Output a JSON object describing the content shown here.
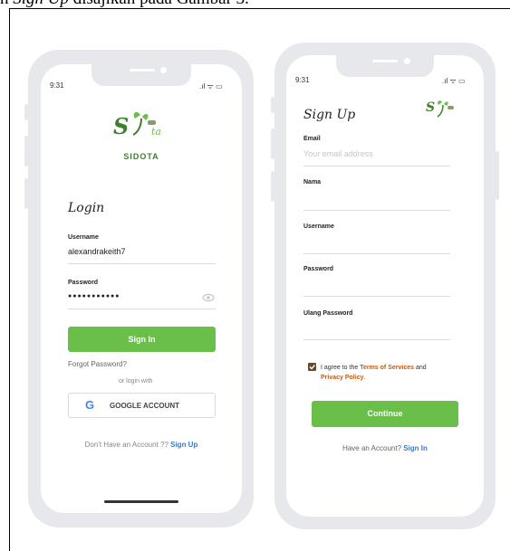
{
  "caption": {
    "prefix": "n ",
    "italic": "Sign Up",
    "suffix": " disajikan pada Gambar 3."
  },
  "login": {
    "time": "9:31",
    "signal": ".ıl ᯤ ▭",
    "brand": "SIDOTA",
    "logo_text": "S",
    "logo_script": "ta",
    "title": "Login",
    "username_label": "Username",
    "username_value": "alexandrakeith7",
    "password_label": "Password",
    "password_value": "●●●●●●●●●●●",
    "signin_button": "Sign In",
    "forgot": "Forgot Password?",
    "or_login": "or login with",
    "google_button": "GOOGLE ACCOUNT",
    "no_account": "Don't Have an Account ?? ",
    "signup_link": "Sign Up"
  },
  "signup": {
    "time": "9:31",
    "signal": ".ıl ᯤ ▭",
    "logo_text": "S",
    "title": "Sign Up",
    "email_label": "Email",
    "email_placeholder": "Your email address",
    "nama_label": "Nama",
    "username_label": "Username",
    "password_label": "Password",
    "ulang_label": "Ulang Password",
    "agree_prefix": "I agree to the ",
    "terms": "Terms of Services",
    "and": " and",
    "privacy": "Privacy Policy",
    "period": ".",
    "continue_button": "Continue",
    "have_account": "Have an Account? ",
    "signin_link": "Sign In"
  },
  "colors": {
    "accent": "#6abf4b",
    "link_blue": "#3a78c9",
    "link_orange": "#c05a16",
    "frame": "#e6e8ec"
  }
}
